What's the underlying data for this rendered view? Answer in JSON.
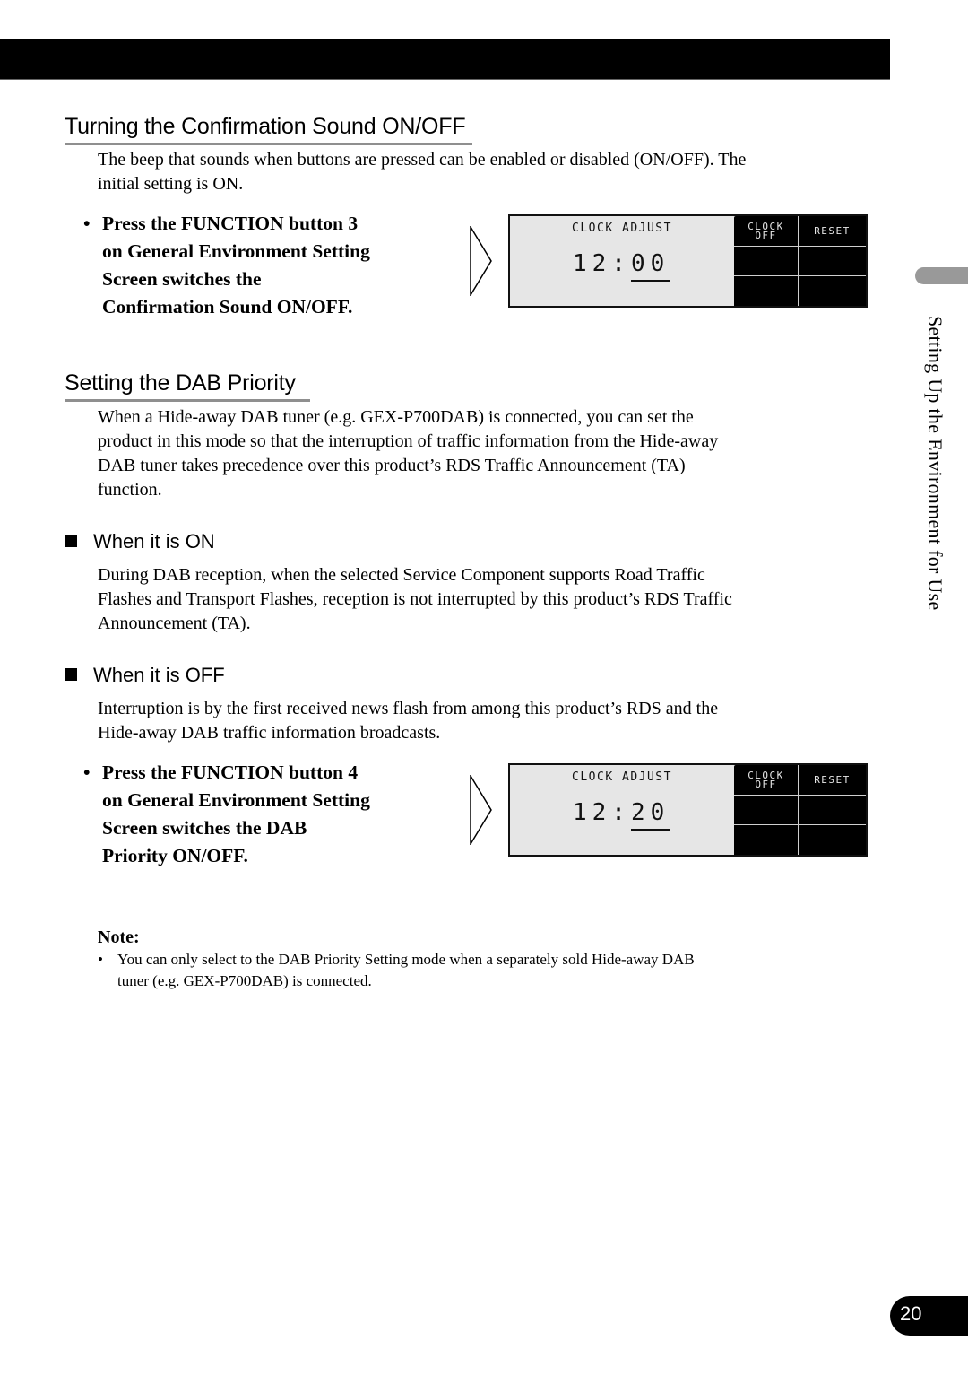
{
  "section1": {
    "title": "Turning the Confirmation Sound ON/OFF",
    "description_lines": [
      "The beep that sounds when buttons are pressed can be enabled or disabled (ON/OFF). The",
      "initial setting is ON."
    ],
    "step": {
      "bullet": "•",
      "lines": [
        "Press the FUNCTION button 3",
        "on General Environment Setting",
        "Screen switches the",
        "Confirmation Sound ON/OFF."
      ]
    },
    "screen": {
      "title": "CLOCK ADJUST",
      "time_hour": "12:",
      "time_minute": "00",
      "buttons": [
        {
          "label_line1": "CLOCK",
          "label_line2": "OFF"
        },
        {
          "label_line1": "RESET",
          "label_line2": ""
        },
        {
          "label_line1": "",
          "label_line2": ""
        },
        {
          "label_line1": "",
          "label_line2": ""
        },
        {
          "label_line1": "",
          "label_line2": ""
        },
        {
          "label_line1": "",
          "label_line2": ""
        }
      ]
    }
  },
  "section2": {
    "title": "Setting the DAB Priority",
    "description_lines": [
      "When a Hide-away DAB tuner (e.g. GEX-P700DAB) is connected, you can set the",
      "product in this mode so that the interruption of traffic information from the Hide-away",
      "DAB tuner takes precedence over this product’s RDS Traffic Announcement (TA)",
      "function."
    ],
    "when_on": {
      "title": "When it is ON",
      "lines": [
        "During DAB reception, when the selected Service Component supports Road Traffic",
        "Flashes and Transport Flashes, reception is not interrupted by this product’s RDS Traffic",
        "Announcement (TA)."
      ]
    },
    "when_off": {
      "title": "When it is OFF",
      "lines": [
        "Interruption is by the first received news flash from among this product’s RDS and the",
        "Hide-away DAB traffic information broadcasts."
      ]
    },
    "step": {
      "bullet": "•",
      "lines": [
        "Press the FUNCTION button 4",
        "on General Environment Setting",
        "Screen switches the DAB",
        "Priority ON/OFF."
      ]
    },
    "screen": {
      "title": "CLOCK ADJUST",
      "time_hour": "12:",
      "time_minute": "20",
      "buttons": [
        {
          "label_line1": "CLOCK",
          "label_line2": "OFF"
        },
        {
          "label_line1": "RESET",
          "label_line2": ""
        },
        {
          "label_line1": "",
          "label_line2": ""
        },
        {
          "label_line1": "",
          "label_line2": ""
        },
        {
          "label_line1": "",
          "label_line2": ""
        },
        {
          "label_line1": "",
          "label_line2": ""
        }
      ]
    }
  },
  "note": {
    "label": "Note:",
    "bullet": "•",
    "lines": [
      "You can only select to the DAB Priority Setting mode when a separately sold Hide-away DAB",
      "tuner (e.g. GEX-P700DAB) is connected."
    ]
  },
  "side_label": "Setting Up the Environment for Use",
  "page_number": "20",
  "icons": {
    "step_arrow": "arrow-right-outline-icon",
    "subsection_marker": "black-square-icon"
  },
  "colors": {
    "heading_rule": "#8f8f8f",
    "side_tab": "#999999",
    "lcd_background": "#e6e6e6",
    "header_bar": "#000000"
  }
}
